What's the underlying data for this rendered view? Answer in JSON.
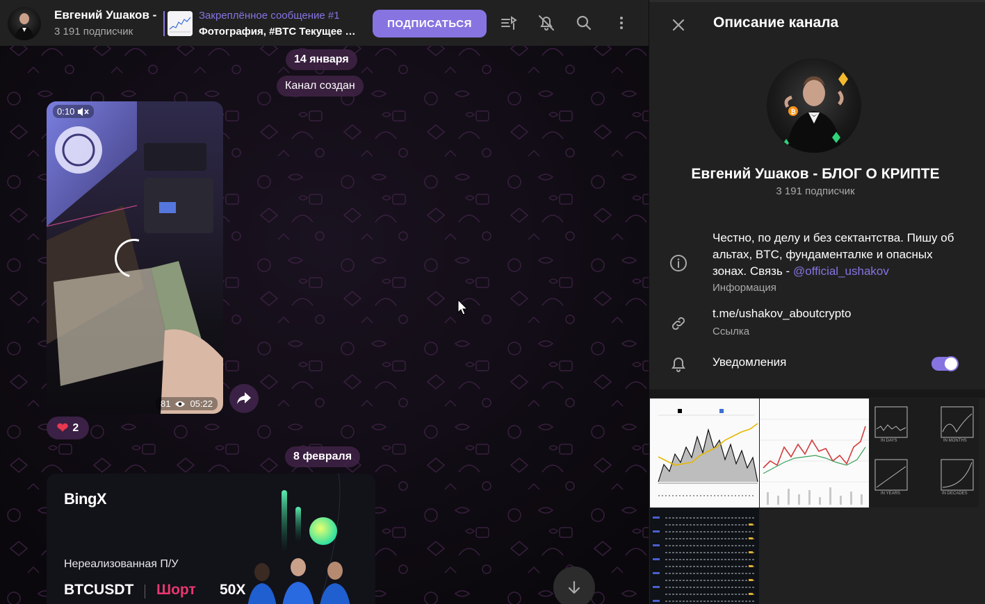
{
  "header": {
    "channel_name": "Евгений Ушаков -",
    "subscribers": "3 191 подписчик",
    "pinned_title": "Закреплённое сообщение #1",
    "pinned_text": "Фотография, #BTC Текущее д...",
    "subscribe_label": "ПОДПИСАТЬСЯ",
    "icons": [
      "voice-chat-icon",
      "mute-icon",
      "search-icon",
      "more-icon"
    ]
  },
  "chat": {
    "date1": "14 января",
    "service_message": "Канал создан",
    "video": {
      "time": "0:10",
      "views": "81",
      "duration": "05:22"
    },
    "reaction": {
      "emoji": "❤",
      "count": "2"
    },
    "date2": "8 февраля",
    "ad": {
      "logo": "BingX",
      "pnl_label": "Нереализованная П/У",
      "pair": "BTCUSDT",
      "side": "Шорт",
      "leverage": "50X"
    },
    "accent_color": "#8774e1"
  },
  "panel": {
    "title": "Описание канала",
    "name": "Евгений Ушаков - БЛОГ О КРИПТЕ",
    "subscribers": "3 191 подписчик",
    "description_text": "Честно, по делу и без сектантства. Пишу об альтах, BTC, фундаменталке и опасных зонах. Связь - ",
    "description_link": "@official_ushakov",
    "description_caption": "Информация",
    "link": "t.me/ushakov_aboutcrypto",
    "link_caption": "Ссылка",
    "notifications_label": "Уведомления",
    "notifications_enabled": true,
    "media_labels": [
      "IN DAYS",
      "IN MONTHS",
      "IN YEARS",
      "IN DECADES"
    ]
  }
}
